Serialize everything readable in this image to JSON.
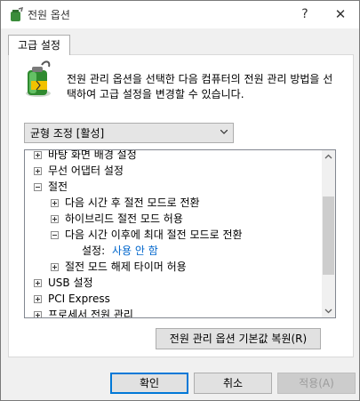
{
  "window": {
    "title": "전원 옵션",
    "help_glyph": "?",
    "close_glyph": "✕"
  },
  "tabs": [
    {
      "label": "고급 설정"
    }
  ],
  "description": "전원 관리 옵션을 선택한 다음 컴퓨터의 전원 관리 방법을 선택하여 고급 설정을 변경할 수 있습니다.",
  "plan_select": {
    "value": "균형 조정 [활성]"
  },
  "tree": {
    "items": [
      {
        "label": "바탕 화면 배경 설정",
        "level": 0,
        "expander": "plus"
      },
      {
        "label": "무선 어댑터 설정",
        "level": 0,
        "expander": "plus"
      },
      {
        "label": "절전",
        "level": 0,
        "expander": "minus"
      },
      {
        "label": "다음 시간 후 절전 모드로 전환",
        "level": 1,
        "expander": "plus"
      },
      {
        "label": "하이브리드 절전 모드 허용",
        "level": 1,
        "expander": "plus"
      },
      {
        "label": "다음 시간 이후에 최대 절전 모드로 전환",
        "level": 1,
        "expander": "minus"
      },
      {
        "label": "설정:",
        "value": "사용 안 함",
        "level": 2,
        "expander": "none"
      },
      {
        "label": "절전 모드 해제 타이머 허용",
        "level": 1,
        "expander": "plus"
      },
      {
        "label": "USB 설정",
        "level": 0,
        "expander": "plus"
      },
      {
        "label": "PCI Express",
        "level": 0,
        "expander": "plus"
      },
      {
        "label": "프로세서 전원 관리",
        "level": 0,
        "expander": "plus"
      }
    ]
  },
  "buttons": {
    "restore": "전원 관리 옵션 기본값 복원(R)",
    "ok": "확인",
    "cancel": "취소",
    "apply": "적용(A)"
  }
}
